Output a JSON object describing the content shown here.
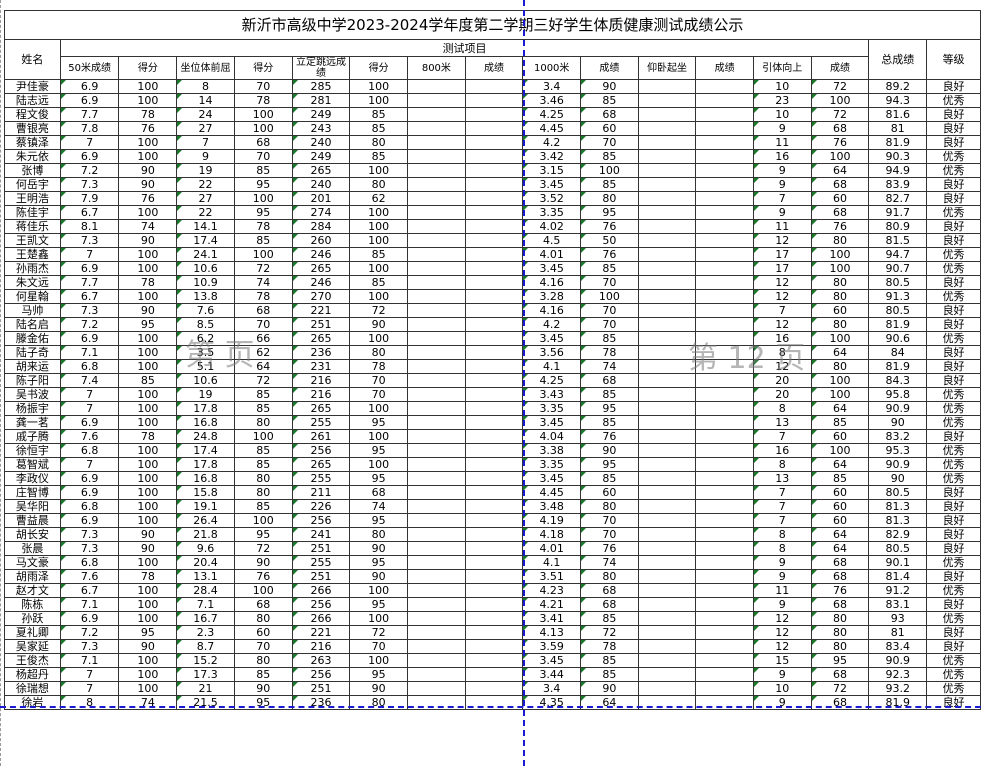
{
  "title": "新沂市高级中学2023-2024学年度第二学期三好学生体质健康测试成绩公示",
  "header": {
    "name": "姓名",
    "group": "测试项目",
    "total": "总成绩",
    "grade": "等级",
    "cols": [
      "50米成绩",
      "得分",
      "坐位体前屈",
      "得分",
      "立定跳远成绩",
      "得分",
      "800米",
      "成绩",
      "1000米",
      "成绩",
      "仰卧起坐",
      "成绩",
      "引体向上",
      "成绩"
    ]
  },
  "watermarks": {
    "left": "第 页",
    "right": "第 12 页"
  },
  "rows": [
    [
      "尹佳豪",
      "6.9",
      "100",
      "8",
      "70",
      "285",
      "100",
      "",
      "",
      "3.4",
      "90",
      "",
      "",
      "10",
      "72",
      "89.2",
      "良好"
    ],
    [
      "陆志远",
      "6.9",
      "100",
      "14",
      "78",
      "281",
      "100",
      "",
      "",
      "3.46",
      "85",
      "",
      "",
      "23",
      "100",
      "94.3",
      "优秀"
    ],
    [
      "程文俊",
      "7.7",
      "78",
      "24",
      "100",
      "249",
      "85",
      "",
      "",
      "4.25",
      "68",
      "",
      "",
      "10",
      "72",
      "81.6",
      "良好"
    ],
    [
      "曹银亮",
      "7.8",
      "76",
      "27",
      "100",
      "243",
      "85",
      "",
      "",
      "4.45",
      "60",
      "",
      "",
      "9",
      "68",
      "81",
      "良好"
    ],
    [
      "蔡镇泽",
      "7",
      "100",
      "7",
      "68",
      "240",
      "80",
      "",
      "",
      "4.2",
      "70",
      "",
      "",
      "11",
      "76",
      "81.9",
      "良好"
    ],
    [
      "朱元依",
      "6.9",
      "100",
      "9",
      "70",
      "249",
      "85",
      "",
      "",
      "3.42",
      "85",
      "",
      "",
      "16",
      "100",
      "90.3",
      "优秀"
    ],
    [
      "张博",
      "7.2",
      "90",
      "19",
      "85",
      "265",
      "100",
      "",
      "",
      "3.15",
      "100",
      "",
      "",
      "9",
      "64",
      "94.9",
      "优秀"
    ],
    [
      "何岳宇",
      "7.3",
      "90",
      "22",
      "95",
      "240",
      "80",
      "",
      "",
      "3.45",
      "85",
      "",
      "",
      "9",
      "68",
      "83.9",
      "良好"
    ],
    [
      "王明浩",
      "7.9",
      "76",
      "27",
      "100",
      "201",
      "62",
      "",
      "",
      "3.52",
      "80",
      "",
      "",
      "7",
      "60",
      "82.7",
      "良好"
    ],
    [
      "陈佳宇",
      "6.7",
      "100",
      "22",
      "95",
      "274",
      "100",
      "",
      "",
      "3.35",
      "95",
      "",
      "",
      "9",
      "68",
      "91.7",
      "优秀"
    ],
    [
      "蒋佳乐",
      "8.1",
      "74",
      "14.1",
      "78",
      "284",
      "100",
      "",
      "",
      "4.02",
      "76",
      "",
      "",
      "11",
      "76",
      "80.9",
      "良好"
    ],
    [
      "王凯文",
      "7.3",
      "90",
      "17.4",
      "85",
      "260",
      "100",
      "",
      "",
      "4.5",
      "50",
      "",
      "",
      "12",
      "80",
      "81.5",
      "良好"
    ],
    [
      "王楚鑫",
      "7",
      "100",
      "24.1",
      "100",
      "246",
      "85",
      "",
      "",
      "4.01",
      "76",
      "",
      "",
      "17",
      "100",
      "94.7",
      "优秀"
    ],
    [
      "孙雨杰",
      "6.9",
      "100",
      "10.6",
      "72",
      "265",
      "100",
      "",
      "",
      "3.45",
      "85",
      "",
      "",
      "17",
      "100",
      "90.7",
      "优秀"
    ],
    [
      "朱文远",
      "7.7",
      "78",
      "10.9",
      "74",
      "246",
      "85",
      "",
      "",
      "4.16",
      "70",
      "",
      "",
      "12",
      "80",
      "80.5",
      "良好"
    ],
    [
      "何星翰",
      "6.7",
      "100",
      "13.8",
      "78",
      "270",
      "100",
      "",
      "",
      "3.28",
      "100",
      "",
      "",
      "12",
      "80",
      "91.3",
      "优秀"
    ],
    [
      "马帅",
      "7.3",
      "90",
      "7.6",
      "68",
      "221",
      "72",
      "",
      "",
      "4.16",
      "70",
      "",
      "",
      "7",
      "60",
      "80.5",
      "良好"
    ],
    [
      "陆名启",
      "7.2",
      "95",
      "8.5",
      "70",
      "251",
      "90",
      "",
      "",
      "4.2",
      "70",
      "",
      "",
      "12",
      "80",
      "81.9",
      "良好"
    ],
    [
      "滕金佑",
      "6.9",
      "100",
      "6.2",
      "66",
      "265",
      "100",
      "",
      "",
      "3.45",
      "85",
      "",
      "",
      "16",
      "100",
      "90.6",
      "优秀"
    ],
    [
      "陆子奇",
      "7.1",
      "100",
      "3.5",
      "62",
      "236",
      "80",
      "",
      "",
      "3.56",
      "78",
      "",
      "",
      "8",
      "64",
      "84",
      "良好"
    ],
    [
      "胡来运",
      "6.8",
      "100",
      "5.1",
      "64",
      "231",
      "78",
      "",
      "",
      "4.1",
      "74",
      "",
      "",
      "12",
      "80",
      "81.9",
      "良好"
    ],
    [
      "陈子阳",
      "7.4",
      "85",
      "10.6",
      "72",
      "216",
      "70",
      "",
      "",
      "4.25",
      "68",
      "",
      "",
      "20",
      "100",
      "84.3",
      "良好"
    ],
    [
      "吴书波",
      "7",
      "100",
      "19",
      "85",
      "216",
      "70",
      "",
      "",
      "3.43",
      "85",
      "",
      "",
      "20",
      "100",
      "95.8",
      "优秀"
    ],
    [
      "杨振宇",
      "7",
      "100",
      "17.8",
      "85",
      "265",
      "100",
      "",
      "",
      "3.35",
      "95",
      "",
      "",
      "8",
      "64",
      "90.9",
      "优秀"
    ],
    [
      "龚一茗",
      "6.9",
      "100",
      "16.8",
      "80",
      "255",
      "95",
      "",
      "",
      "3.45",
      "85",
      "",
      "",
      "13",
      "85",
      "90",
      "优秀"
    ],
    [
      "戚子腾",
      "7.6",
      "78",
      "24.8",
      "100",
      "261",
      "100",
      "",
      "",
      "4.04",
      "76",
      "",
      "",
      "7",
      "60",
      "83.2",
      "良好"
    ],
    [
      "徐恒宇",
      "6.8",
      "100",
      "17.4",
      "85",
      "256",
      "95",
      "",
      "",
      "3.38",
      "90",
      "",
      "",
      "16",
      "100",
      "95.3",
      "优秀"
    ],
    [
      "葛智斌",
      "7",
      "100",
      "17.8",
      "85",
      "265",
      "100",
      "",
      "",
      "3.35",
      "95",
      "",
      "",
      "8",
      "64",
      "90.9",
      "优秀"
    ],
    [
      "李政仪",
      "6.9",
      "100",
      "16.8",
      "80",
      "255",
      "95",
      "",
      "",
      "3.45",
      "85",
      "",
      "",
      "13",
      "85",
      "90",
      "优秀"
    ],
    [
      "庄智博",
      "6.9",
      "100",
      "15.8",
      "80",
      "211",
      "68",
      "",
      "",
      "4.45",
      "60",
      "",
      "",
      "7",
      "60",
      "80.5",
      "良好"
    ],
    [
      "吴华阳",
      "6.8",
      "100",
      "19.1",
      "85",
      "226",
      "74",
      "",
      "",
      "3.48",
      "80",
      "",
      "",
      "7",
      "60",
      "81.3",
      "良好"
    ],
    [
      "曹益晨",
      "6.9",
      "100",
      "26.4",
      "100",
      "256",
      "95",
      "",
      "",
      "4.19",
      "70",
      "",
      "",
      "7",
      "60",
      "81.3",
      "良好"
    ],
    [
      "胡长安",
      "7.3",
      "90",
      "21.8",
      "95",
      "241",
      "80",
      "",
      "",
      "4.18",
      "70",
      "",
      "",
      "8",
      "64",
      "82.9",
      "良好"
    ],
    [
      "张晨",
      "7.3",
      "90",
      "9.6",
      "72",
      "251",
      "90",
      "",
      "",
      "4.01",
      "76",
      "",
      "",
      "8",
      "64",
      "80.5",
      "良好"
    ],
    [
      "马文豪",
      "6.8",
      "100",
      "20.4",
      "90",
      "255",
      "95",
      "",
      "",
      "4.1",
      "74",
      "",
      "",
      "9",
      "68",
      "90.1",
      "优秀"
    ],
    [
      "胡雨泽",
      "7.6",
      "78",
      "13.1",
      "76",
      "251",
      "90",
      "",
      "",
      "3.51",
      "80",
      "",
      "",
      "9",
      "68",
      "81.4",
      "良好"
    ],
    [
      "赵才文",
      "6.7",
      "100",
      "28.4",
      "100",
      "266",
      "100",
      "",
      "",
      "4.23",
      "68",
      "",
      "",
      "11",
      "76",
      "91.2",
      "优秀"
    ],
    [
      "陈栋",
      "7.1",
      "100",
      "7.1",
      "68",
      "256",
      "95",
      "",
      "",
      "4.21",
      "68",
      "",
      "",
      "9",
      "68",
      "83.1",
      "良好"
    ],
    [
      "孙跃",
      "6.9",
      "100",
      "16.7",
      "80",
      "266",
      "100",
      "",
      "",
      "3.41",
      "85",
      "",
      "",
      "12",
      "80",
      "93",
      "优秀"
    ],
    [
      "夏礼卿",
      "7.2",
      "95",
      "2.3",
      "60",
      "221",
      "72",
      "",
      "",
      "4.13",
      "72",
      "",
      "",
      "12",
      "80",
      "81",
      "良好"
    ],
    [
      "吴家延",
      "7.3",
      "90",
      "8.7",
      "70",
      "216",
      "70",
      "",
      "",
      "3.59",
      "78",
      "",
      "",
      "12",
      "80",
      "83.4",
      "良好"
    ],
    [
      "王俊杰",
      "7.1",
      "100",
      "15.2",
      "80",
      "263",
      "100",
      "",
      "",
      "3.45",
      "85",
      "",
      "",
      "15",
      "95",
      "90.9",
      "优秀"
    ],
    [
      "杨超丹",
      "7",
      "100",
      "17.3",
      "85",
      "256",
      "95",
      "",
      "",
      "3.44",
      "85",
      "",
      "",
      "9",
      "68",
      "92.3",
      "优秀"
    ],
    [
      "徐瑞想",
      "7",
      "100",
      "21",
      "90",
      "251",
      "90",
      "",
      "",
      "3.4",
      "90",
      "",
      "",
      "10",
      "72",
      "93.2",
      "优秀"
    ],
    [
      "徐岩",
      "8",
      "74",
      "21.5",
      "95",
      "236",
      "80",
      "",
      "",
      "4.35",
      "64",
      "",
      "",
      "9",
      "68",
      "81.9",
      "良好"
    ]
  ]
}
